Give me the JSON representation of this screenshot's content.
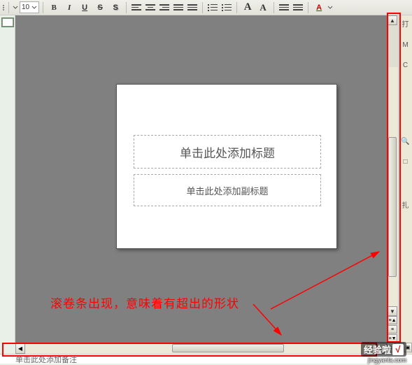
{
  "toolbar": {
    "font_size": "10",
    "bold": "B",
    "italic": "I",
    "underline": "U",
    "strike": "S",
    "shadow": "S",
    "big_a": "A",
    "small_a": "A"
  },
  "slide": {
    "title_placeholder": "单击此处添加标题",
    "subtitle_placeholder": "单击此处添加副标题"
  },
  "annotation": "滚卷条出现，意味着有超出的形状",
  "notes_placeholder": "单击此处添加备注",
  "right_panel": {
    "item_open": "打",
    "item_m": "M",
    "item_c": "C",
    "item_search_icon": "🔍",
    "item_box_icon": "□",
    "item_more": "扎"
  },
  "watermark": {
    "brand": "经验啦",
    "check": "√",
    "url": "jingyanla.com"
  }
}
